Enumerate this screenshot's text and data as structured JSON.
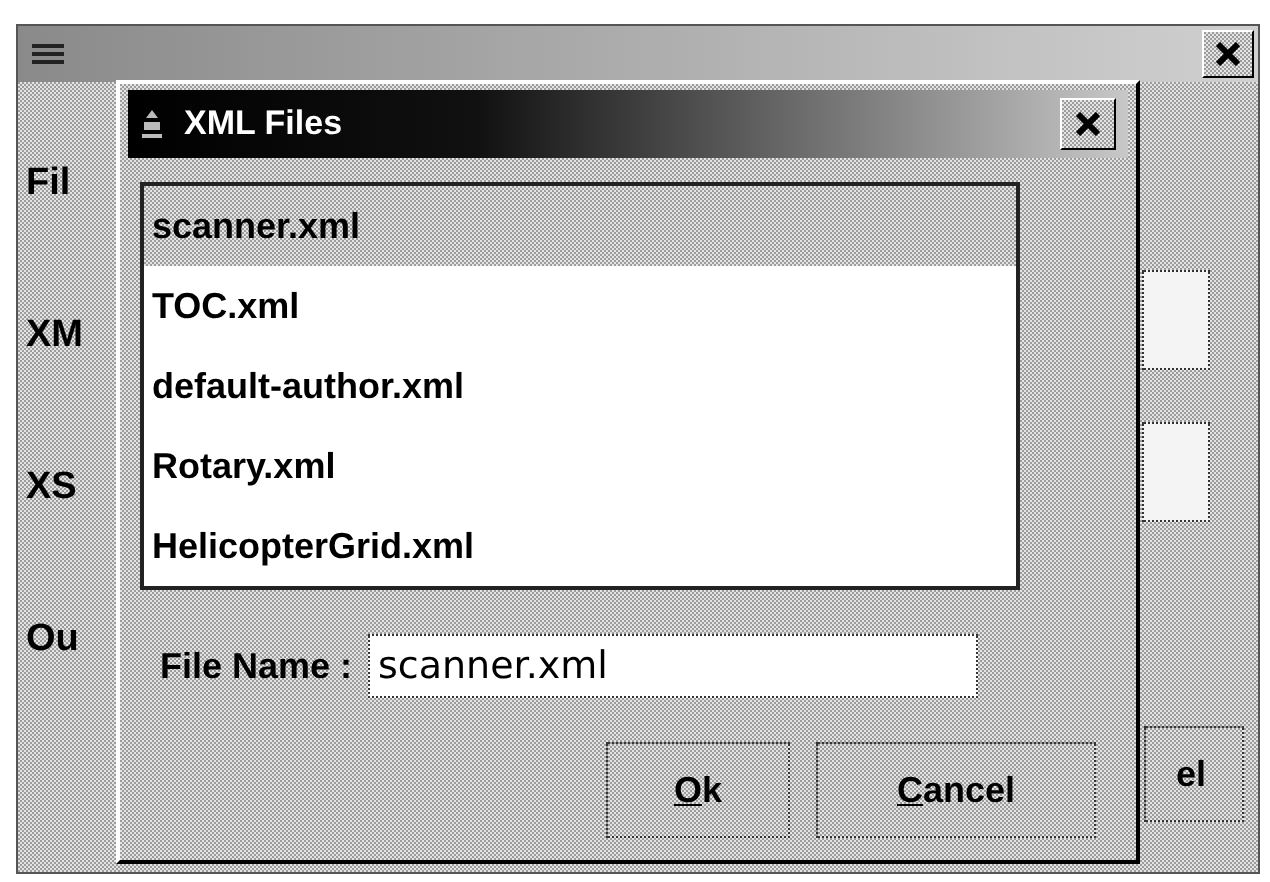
{
  "background_window": {
    "labels": [
      "Fil",
      "XM",
      "XS",
      "Ou"
    ],
    "button_fragment": "el"
  },
  "dialog": {
    "title": "XML Files",
    "files": [
      {
        "name": "scanner.xml",
        "selected": true
      },
      {
        "name": "TOC.xml",
        "selected": false
      },
      {
        "name": "default-author.xml",
        "selected": false
      },
      {
        "name": "Rotary.xml",
        "selected": false
      },
      {
        "name": "HelicopterGrid.xml",
        "selected": false
      }
    ],
    "file_name_label": "File Name :",
    "file_name_value": "scanner.xml",
    "buttons": [
      "Ok",
      "Cancel"
    ]
  }
}
